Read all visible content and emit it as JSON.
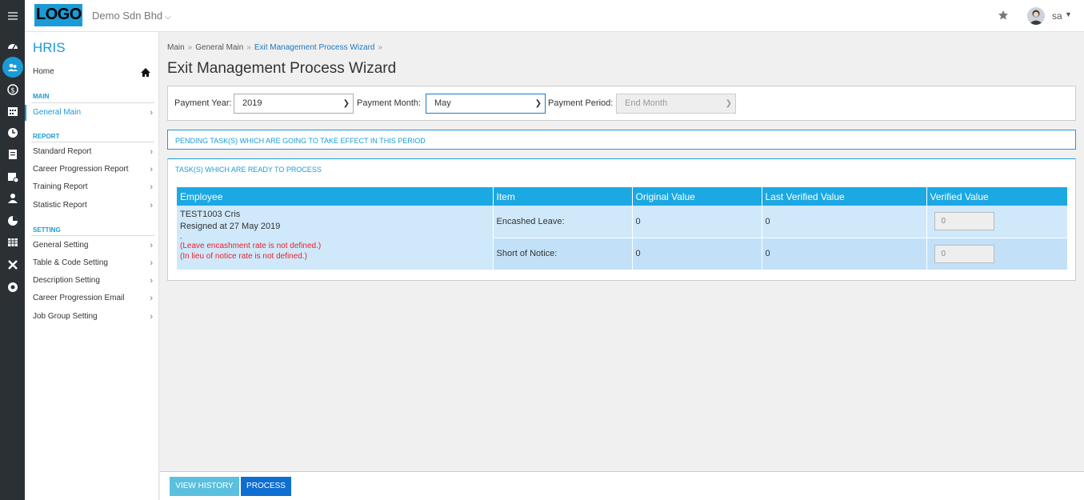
{
  "header": {
    "logo": "LOGO",
    "company": "Demo Sdn Bhd",
    "user": "sa"
  },
  "sidebar": {
    "title": "HRIS",
    "home": "Home",
    "sections": {
      "main": "MAIN",
      "report": "REPORT",
      "setting": "SETTING"
    },
    "main_items": [
      "General Main"
    ],
    "report_items": [
      "Standard Report",
      "Career Progression Report",
      "Training Report",
      "Statistic Report"
    ],
    "setting_items": [
      "General Setting",
      "Table & Code Setting",
      "Description Setting",
      "Career Progression Email",
      "Job Group Setting"
    ]
  },
  "breadcrumb": [
    "Main",
    "General Main",
    "Exit Management Process Wizard"
  ],
  "page_title": "Exit Management Process Wizard",
  "filters": {
    "year_label": "Payment Year:",
    "year_value": "2019",
    "month_label": "Payment Month:",
    "month_value": "May",
    "period_label": "Payment Period:",
    "period_value": "End Month"
  },
  "pending_title": "PENDING TASK(S) WHICH ARE GOING TO TAKE EFFECT IN THIS PERIOD",
  "ready_title": "TASK(S) WHICH ARE READY TO PROCESS",
  "table": {
    "headers": [
      "Employee",
      "Item",
      "Original Value",
      "Last Verified Value",
      "Verified Value"
    ],
    "employee": {
      "line1": "TEST1003 Cris",
      "line2": "Resigned at 27 May 2019",
      "line3": ",",
      "error1": "(Leave encashment rate is not defined.)",
      "error2": "(In lieu of notice rate is not defined.)"
    },
    "rows": [
      {
        "item": "Encashed Leave:",
        "original": "0",
        "last_verified": "0",
        "verified": "0"
      },
      {
        "item": "Short of Notice:",
        "original": "0",
        "last_verified": "0",
        "verified": "0"
      }
    ]
  },
  "footer": {
    "history_label": "VIEW HISTORY",
    "process_label": "PROCESS"
  },
  "colors": {
    "accent": "#1a9bd7",
    "header_row": "#1ca8e3",
    "row_bg": "#cfe9fb",
    "error": "#e6232f",
    "rail": "#2b3035"
  }
}
